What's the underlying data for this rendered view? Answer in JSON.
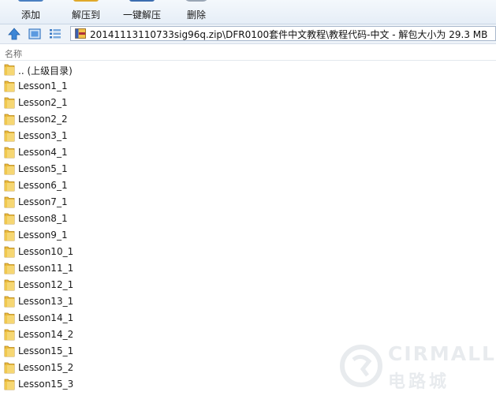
{
  "toolbar": {
    "buttons": [
      {
        "label": "添加",
        "icon": "add-icon",
        "color": "#4a7fc1"
      },
      {
        "label": "解压到",
        "icon": "extract-to-icon",
        "color": "#e0a92a"
      },
      {
        "label": "一键解压",
        "icon": "one-click-extract-icon",
        "color": "#3c6db0"
      },
      {
        "label": "删除",
        "icon": "delete-icon",
        "color": "#9aa6b5"
      }
    ]
  },
  "address": {
    "path": "20141113110733sig96q.zip\\DFR0100套件中文教程\\教程代码-中文 - 解包大小为 29.3 MB"
  },
  "columns": {
    "name": "名称"
  },
  "files": [
    {
      "label": ".. (上级目录)"
    },
    {
      "label": "Lesson1_1"
    },
    {
      "label": "Lesson2_1"
    },
    {
      "label": "Lesson2_2"
    },
    {
      "label": "Lesson3_1"
    },
    {
      "label": "Lesson4_1"
    },
    {
      "label": "Lesson5_1"
    },
    {
      "label": "Lesson6_1"
    },
    {
      "label": "Lesson7_1"
    },
    {
      "label": "Lesson8_1"
    },
    {
      "label": "Lesson9_1"
    },
    {
      "label": "Lesson10_1"
    },
    {
      "label": "Lesson11_1"
    },
    {
      "label": "Lesson12_1"
    },
    {
      "label": "Lesson13_1"
    },
    {
      "label": "Lesson14_1"
    },
    {
      "label": "Lesson14_2"
    },
    {
      "label": "Lesson15_1"
    },
    {
      "label": "Lesson15_2"
    },
    {
      "label": "Lesson15_3"
    }
  ],
  "watermark": {
    "brand": "CIRMALL",
    "brand_cn": "电路城"
  }
}
